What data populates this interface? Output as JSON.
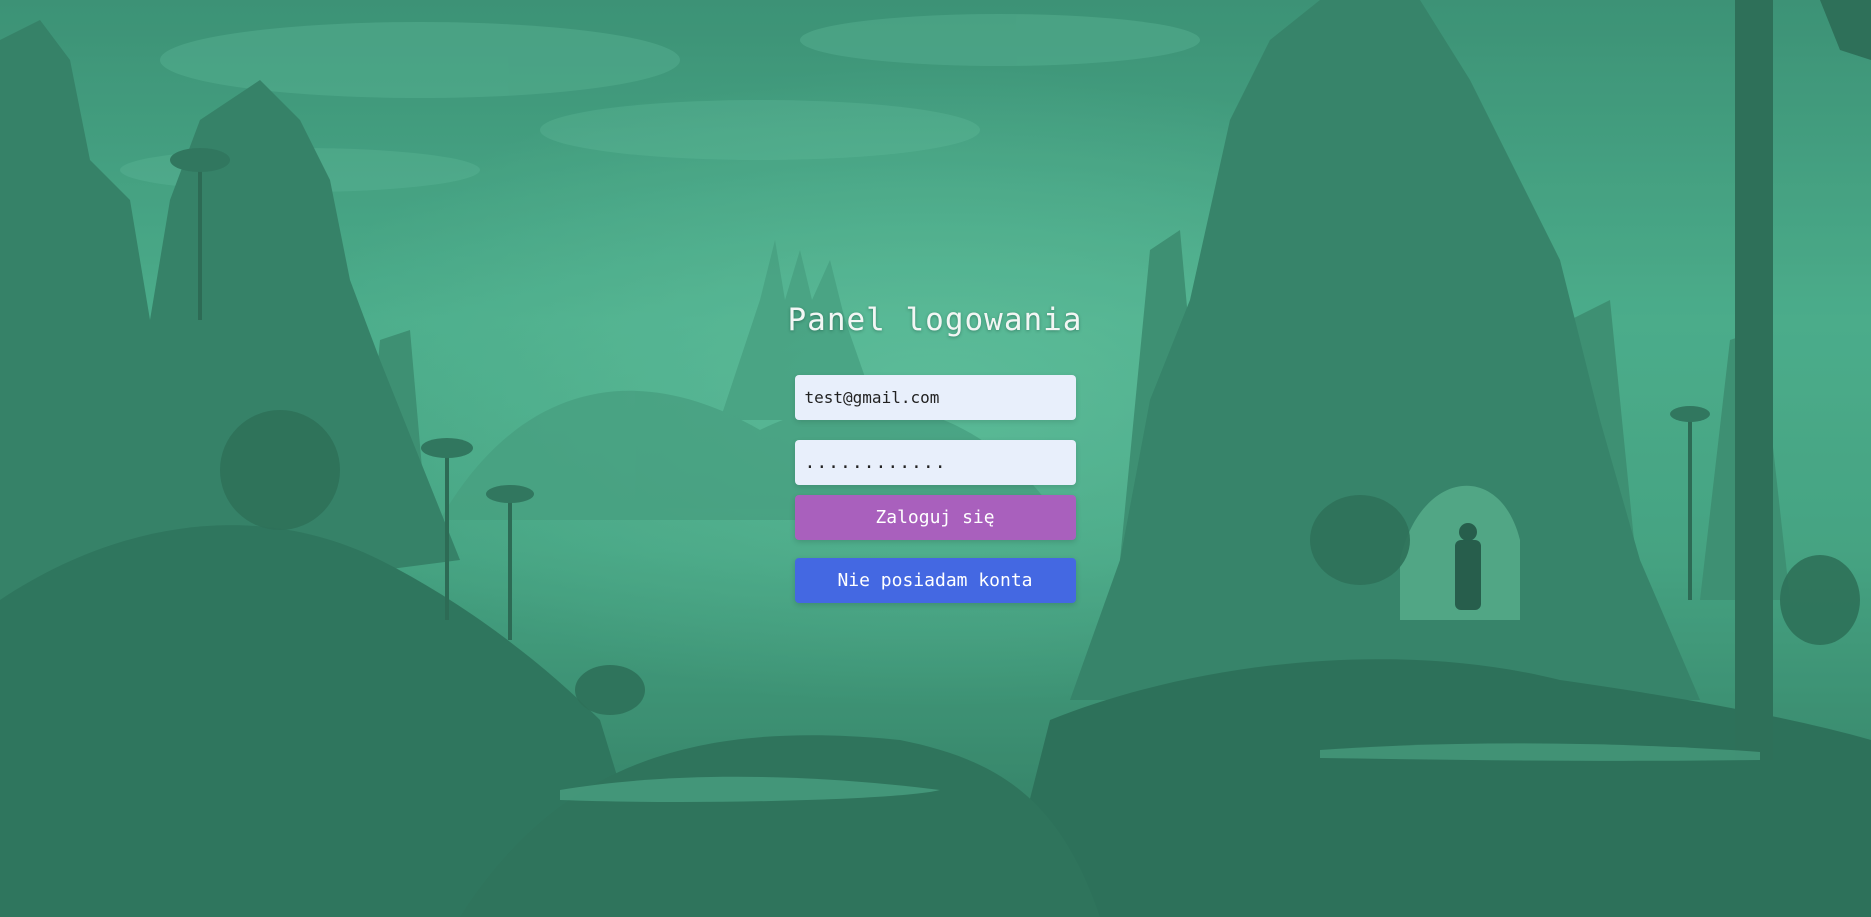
{
  "page": {
    "title": "Panel logowania",
    "overlay_color": "#3fa584",
    "background_description_icon": "fantasy-landscape-background"
  },
  "form": {
    "email": {
      "value": "test@gmail.com",
      "placeholder": ""
    },
    "password": {
      "value": "............",
      "placeholder": ""
    },
    "login_button_label": "Zaloguj się",
    "register_button_label": "Nie posiadam konta",
    "colors": {
      "field_bg": "#e8effb",
      "login_button": "#a960bd",
      "register_button": "#4468e2"
    }
  }
}
